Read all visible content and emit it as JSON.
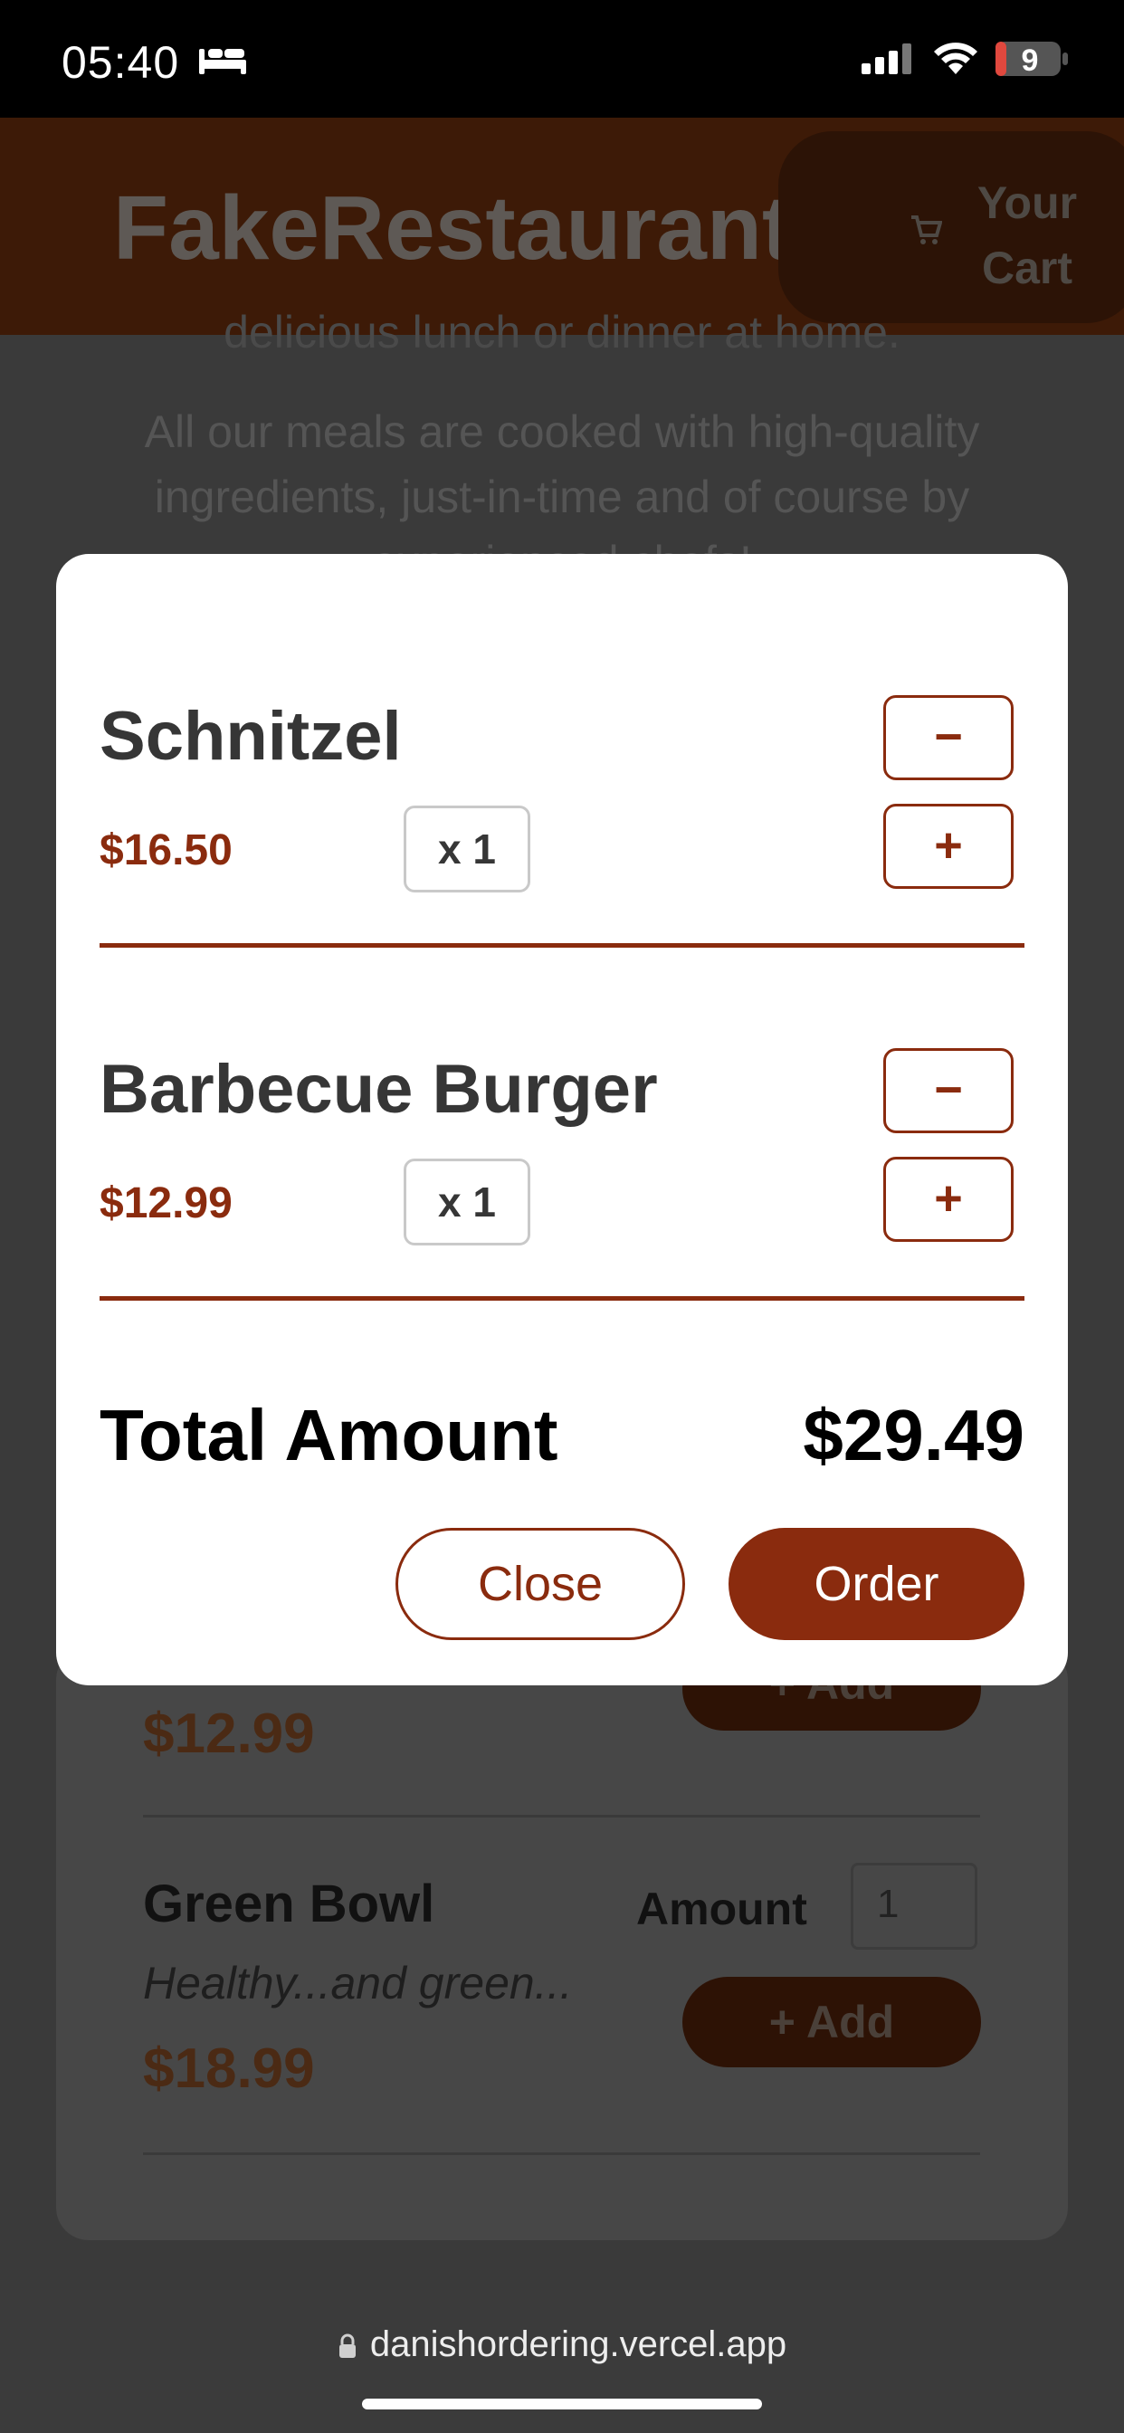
{
  "status_bar": {
    "time": "05:40",
    "battery": "9",
    "icons": [
      "bed-icon",
      "signal-icon",
      "wifi-icon",
      "battery-icon"
    ]
  },
  "header": {
    "logo": "FakeRestaurant",
    "cart_line1": "Your",
    "cart_line2": "Cart",
    "cart_icon": "cart-icon"
  },
  "background": {
    "partial_line": "delicious lunch or dinner at home.",
    "intro_line1": "All our meals are cooked with high-quality",
    "intro_line2": "ingredients, just-in-time and of course by",
    "intro_line3": "experienced chefs!",
    "meal_above_price": "$12.99",
    "meal_above_add": "+ Add",
    "meal_name": "Green Bowl",
    "meal_desc": "Healthy...and green...",
    "meal_price": "$18.99",
    "amount_label": "Amount",
    "amount_value": "1",
    "add_label": "+ Add"
  },
  "cart_modal": {
    "items": [
      {
        "name": "Schnitzel",
        "price": "$16.50",
        "qty": "x 1"
      },
      {
        "name": "Barbecue Burger",
        "price": "$12.99",
        "qty": "x 1"
      }
    ],
    "minus_label": "−",
    "plus_label": "+",
    "total_label": "Total Amount",
    "total_value": "$29.49",
    "close_label": "Close",
    "order_label": "Order"
  },
  "browser": {
    "url": "danishordering.vercel.app",
    "lock_icon": "lock-icon"
  },
  "colors": {
    "accent": "#8a2b0e",
    "header_bg": "#3d1a07",
    "overlay": "#3a3a3a"
  }
}
